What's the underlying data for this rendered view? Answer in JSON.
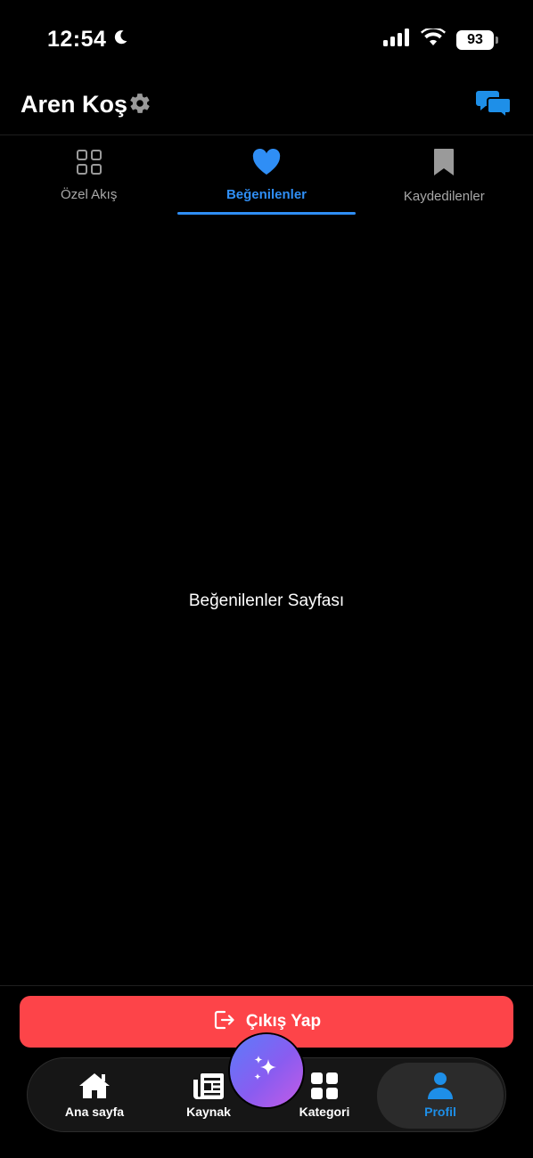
{
  "status_bar": {
    "time": "12:54",
    "battery": "93"
  },
  "header": {
    "user_name": "Aren Koş"
  },
  "tabs": [
    {
      "label": "Özel Akış",
      "icon": "grid-icon",
      "active": false
    },
    {
      "label": "Beğenilenler",
      "icon": "heart-icon",
      "active": true
    },
    {
      "label": "Kaydedilenler",
      "icon": "bookmark-icon",
      "active": false
    }
  ],
  "content": {
    "message": "Beğenilenler Sayfası"
  },
  "logout": {
    "label": "Çıkış Yap"
  },
  "tabbar": {
    "items": [
      {
        "label": "Ana sayfa",
        "icon": "home-icon",
        "active": false
      },
      {
        "label": "Kaynak",
        "icon": "newspaper-icon",
        "active": false
      },
      {
        "label": "Kategori",
        "icon": "category-grid-icon",
        "active": false
      },
      {
        "label": "Profil",
        "icon": "person-icon",
        "active": true
      }
    ],
    "fab_icon": "sparkles-icon"
  },
  "colors": {
    "accent": "#2f8ef5",
    "logout": "#fd4449",
    "background": "#000000"
  }
}
